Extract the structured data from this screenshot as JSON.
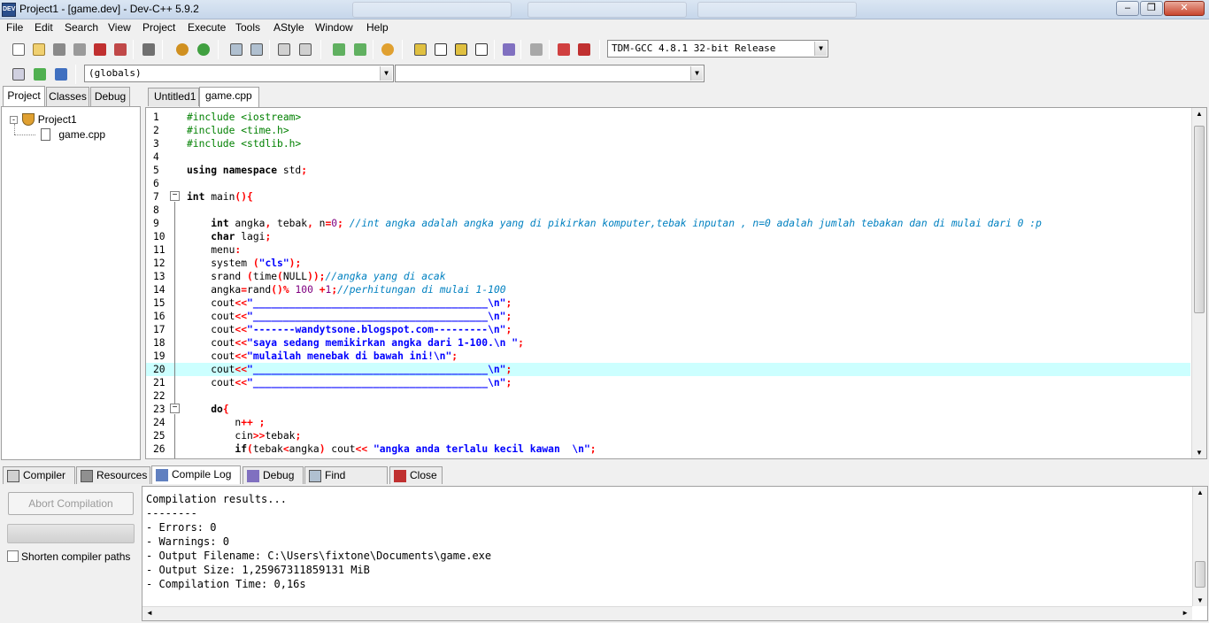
{
  "window": {
    "title": "Project1 - [game.dev] - Dev-C++ 5.9.2",
    "app_icon_text": "DEV"
  },
  "menu": [
    "File",
    "Edit",
    "Search",
    "View",
    "Project",
    "Execute",
    "Tools",
    "AStyle",
    "Window",
    "Help"
  ],
  "toolbar": {
    "compiler_select": "TDM-GCC 4.8.1 32-bit Release",
    "scope_select": "(globals)",
    "function_select": ""
  },
  "left_panel": {
    "tabs": [
      "Project",
      "Classes",
      "Debug"
    ],
    "tree": {
      "project": "Project1",
      "file": "game.cpp"
    }
  },
  "editor": {
    "tabs": [
      "Untitled1",
      "game.cpp"
    ],
    "current_line": 20,
    "lines": [
      {
        "n": "1",
        "html": "<span class=\"pp\">#include &lt;iostream&gt;</span>"
      },
      {
        "n": "2",
        "html": "<span class=\"pp\">#include &lt;time.h&gt;</span>"
      },
      {
        "n": "3",
        "html": "<span class=\"pp\">#include &lt;stdlib.h&gt;</span>"
      },
      {
        "n": "4",
        "html": ""
      },
      {
        "n": "5",
        "html": "<span class=\"kw\">using namespace</span> std<span class=\"sym\">;</span>"
      },
      {
        "n": "6",
        "html": ""
      },
      {
        "n": "7",
        "html": "<span class=\"kw\">int</span> main<span class=\"sym\">(){</span>"
      },
      {
        "n": "8",
        "html": ""
      },
      {
        "n": "9",
        "html": "    <span class=\"kw\">int</span> angka<span class=\"sym\">,</span> tebak<span class=\"sym\">,</span> n<span class=\"sym\">=</span><span class=\"num\">0</span><span class=\"sym\">;</span> <span class=\"cmt\">//int angka adalah angka yang di pikirkan komputer,tebak inputan , n=0 adalah jumlah tebakan dan di mulai dari 0 :p</span>"
      },
      {
        "n": "10",
        "html": "    <span class=\"kw\">char</span> lagi<span class=\"sym\">;</span>"
      },
      {
        "n": "11",
        "html": "    menu<span class=\"sym\">:</span>"
      },
      {
        "n": "12",
        "html": "    system <span class=\"sym\">(</span><span class=\"str\">\"cls\"</span><span class=\"sym\">);</span>"
      },
      {
        "n": "13",
        "html": "    srand <span class=\"sym\">(</span>time<span class=\"sym\">(</span>NULL<span class=\"sym\">));</span><span class=\"cmt\">//angka yang di acak</span>"
      },
      {
        "n": "14",
        "html": "    angka<span class=\"sym\">=</span>rand<span class=\"sym\">()%</span> <span class=\"num\">100</span> <span class=\"sym\">+</span><span class=\"num\">1</span><span class=\"sym\">;</span><span class=\"cmt\">//perhitungan di mulai 1-100</span>"
      },
      {
        "n": "15",
        "html": "    cout<span class=\"sym\">&lt;&lt;</span><span class=\"str\">\"_______________________________________\\n\"</span><span class=\"sym\">;</span>"
      },
      {
        "n": "16",
        "html": "    cout<span class=\"sym\">&lt;&lt;</span><span class=\"str\">\"_______________________________________\\n\"</span><span class=\"sym\">;</span>"
      },
      {
        "n": "17",
        "html": "    cout<span class=\"sym\">&lt;&lt;</span><span class=\"str\">\"-------wandytsone.blogspot.com---------\\n\"</span><span class=\"sym\">;</span>"
      },
      {
        "n": "18",
        "html": "    cout<span class=\"sym\">&lt;&lt;</span><span class=\"str\">\"saya sedang memikirkan angka dari 1-100.\\n \"</span><span class=\"sym\">;</span>"
      },
      {
        "n": "19",
        "html": "    cout<span class=\"sym\">&lt;&lt;</span><span class=\"str\">\"mulailah menebak di bawah ini!\\n\"</span><span class=\"sym\">;</span>"
      },
      {
        "n": "20",
        "html": "    cout<span class=\"sym\">&lt;&lt;</span><span class=\"str\">\"_______________________________________\\n\"</span><span class=\"sym\">;</span>"
      },
      {
        "n": "21",
        "html": "    cout<span class=\"sym\">&lt;&lt;</span><span class=\"str\">\"_______________________________________\\n\"</span><span class=\"sym\">;</span>"
      },
      {
        "n": "22",
        "html": ""
      },
      {
        "n": "23",
        "html": "    <span class=\"kw\">do</span><span class=\"sym\">{</span>"
      },
      {
        "n": "24",
        "html": "        n<span class=\"sym\">++ ;</span>"
      },
      {
        "n": "25",
        "html": "        cin<span class=\"sym\">&gt;&gt;</span>tebak<span class=\"sym\">;</span>"
      },
      {
        "n": "26",
        "html": "        <span class=\"kw\">if</span><span class=\"sym\">(</span>tebak<span class=\"sym\">&lt;</span>angka<span class=\"sym\">)</span> cout<span class=\"sym\">&lt;&lt;</span> <span class=\"str\">\"angka anda terlalu kecil kawan  \\n\"</span><span class=\"sym\">;</span>"
      }
    ]
  },
  "bottom_tabs": [
    "Compiler",
    "Resources",
    "Compile Log",
    "Debug",
    "Find Results",
    "Close"
  ],
  "bottom": {
    "abort_label": "Abort Compilation",
    "shorten_label": "Shorten compiler paths",
    "log": [
      "Compilation results...",
      "--------",
      "- Errors: 0",
      "- Warnings: 0",
      "- Output Filename: C:\\Users\\fixtone\\Documents\\game.exe",
      "- Output Size: 1,25967311859131 MiB",
      "- Compilation Time: 0,16s"
    ]
  }
}
